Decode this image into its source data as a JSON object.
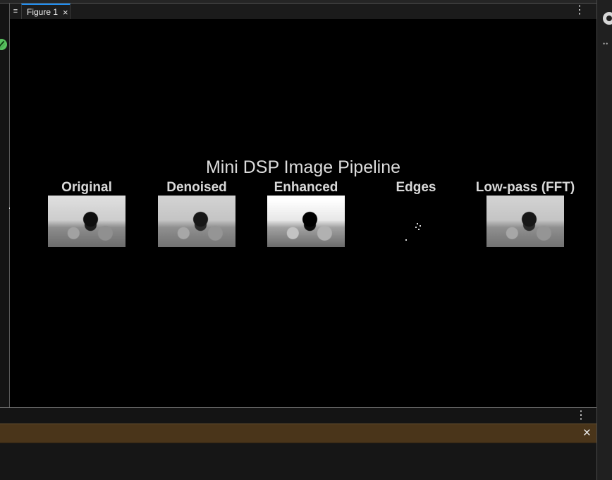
{
  "window": {
    "tab_title": "Figure 1",
    "tab_close_icon": "close-icon",
    "tab_more_icon": "more-icon"
  },
  "figure": {
    "title": "Mini DSP Image Pipeline",
    "panels": [
      {
        "title": "Original"
      },
      {
        "title": "Denoised"
      },
      {
        "title": "Enhanced"
      },
      {
        "title": "Edges"
      },
      {
        "title": "Low-pass (FFT)"
      }
    ]
  },
  "sidebar": {
    "status_icon": "check-icon"
  },
  "dock": {
    "more_icon": "more-icon"
  },
  "notice": {
    "close_icon": "close-icon"
  },
  "right_rail": {
    "top_icon": "extensions-icon"
  },
  "colors": {
    "active_tab_accent": "#1f8ef1",
    "notice_bar": "#4a351a",
    "canvas": "#000000"
  }
}
